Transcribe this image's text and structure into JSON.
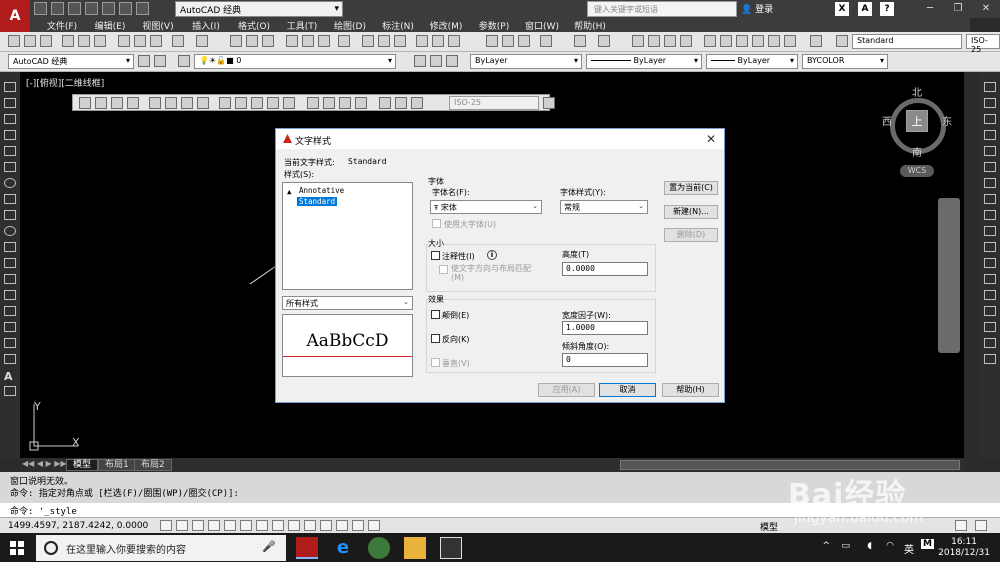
{
  "window": {
    "workspace_select": "AutoCAD 经典",
    "search_placeholder": "键入关键字或短语",
    "login_label": "登录"
  },
  "menu": [
    "文件(F)",
    "编辑(E)",
    "视图(V)",
    "插入(I)",
    "格式(O)",
    "工具(T)",
    "绘图(D)",
    "标注(N)",
    "修改(M)",
    "参数(P)",
    "窗口(W)",
    "帮助(H)"
  ],
  "toolbars": {
    "workspace_combo": "AutoCAD 经典",
    "layer_combo": "0",
    "text_style_combo": "Standard",
    "dim_style_combo": "ISO-25",
    "color_combo": "ByLayer",
    "linetype_combo": "ByLayer",
    "lineweight_combo": "ByLayer",
    "plotstyle_combo": "BYCOLOR"
  },
  "drawing": {
    "viewport_label": "[-][俯视][二维线框]",
    "float_dim_style": "ISO-25",
    "viewcube": {
      "north": "北",
      "south": "南",
      "east": "东",
      "west": "西",
      "face": "上"
    },
    "wcs_label": "WCS",
    "ucs_y": "Y",
    "ucs_x": "X"
  },
  "layout_tabs": [
    {
      "label": "模型",
      "active": true
    },
    {
      "label": "布局1",
      "active": false
    },
    {
      "label": "布局2",
      "active": false
    }
  ],
  "command": {
    "history": [
      "窗口说明无效。",
      "命令: 指定对角点或 [栏选(F)/圈围(WP)/圈交(CP)]:"
    ],
    "current": "命令: '_style"
  },
  "status": {
    "coordinates": "1499.4597, 2187.4242, 0.0000",
    "model_label": "模型"
  },
  "taskbar": {
    "search_placeholder": "在这里输入你要搜索的内容",
    "ime": "英",
    "time": "16:11",
    "date": "2018/12/31"
  },
  "dialog": {
    "title": "文字样式",
    "current_style_label": "当前文字样式:",
    "current_style_value": "Standard",
    "styles_label": "样式(S):",
    "styles": [
      {
        "name": "Annotative",
        "selected": false
      },
      {
        "name": "Standard",
        "selected": true
      }
    ],
    "filter_dropdown": "所有样式",
    "preview_text": "AaBbCcD",
    "font": {
      "group_label": "字体",
      "font_name_label": "字体名(F):",
      "font_name_value": "宋体",
      "font_style_label": "字体样式(Y):",
      "font_style_value": "常规",
      "big_font_label": "使用大字体(U)"
    },
    "size": {
      "group_label": "大小",
      "annotative_label": "注释性(I)",
      "match_orientation_label": "使文字方向与布局匹配(M)",
      "height_label": "高度(T)",
      "height_value": "0.0000"
    },
    "effects": {
      "group_label": "效果",
      "upside_down_label": "颠倒(E)",
      "backwards_label": "反向(K)",
      "vertical_label": "垂直(V)",
      "width_factor_label": "宽度因子(W):",
      "width_factor_value": "1.0000",
      "oblique_label": "倾斜角度(O):",
      "oblique_value": "0"
    },
    "buttons": {
      "set_current": "置为当前(C)",
      "new": "新建(N)...",
      "delete": "删除(D)",
      "apply": "应用(A)",
      "cancel": "取消",
      "help": "帮助(H)"
    }
  },
  "watermark": {
    "brand": "Bai经验",
    "url": "jingyan.baidu.com"
  }
}
